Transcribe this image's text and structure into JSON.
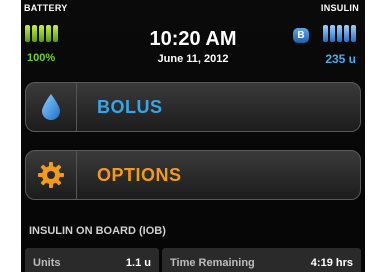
{
  "status": {
    "battery_label": "BATTERY",
    "battery_percent": "100%",
    "battery_level": 1.0,
    "insulin_label": "INSULIN",
    "insulin_badge": "B",
    "insulin_units": "235 u",
    "time": "10:20 AM",
    "date": "June 11, 2012"
  },
  "menu": {
    "bolus_label": "BOLUS",
    "options_label": "OPTIONS"
  },
  "iob": {
    "title": "INSULIN ON BOARD (IOB)",
    "units_label": "Units",
    "units_value": "1.1 u",
    "time_label": "Time Remaining",
    "time_value": "4:19 hrs"
  },
  "colors": {
    "bolus_accent": "#35a6ec",
    "options_accent": "#f39a1e",
    "battery_green": "#6fcf2f",
    "insulin_blue": "#4fa8e8"
  },
  "icons": {
    "bolus": "water-drop-icon",
    "options": "gear-icon"
  }
}
